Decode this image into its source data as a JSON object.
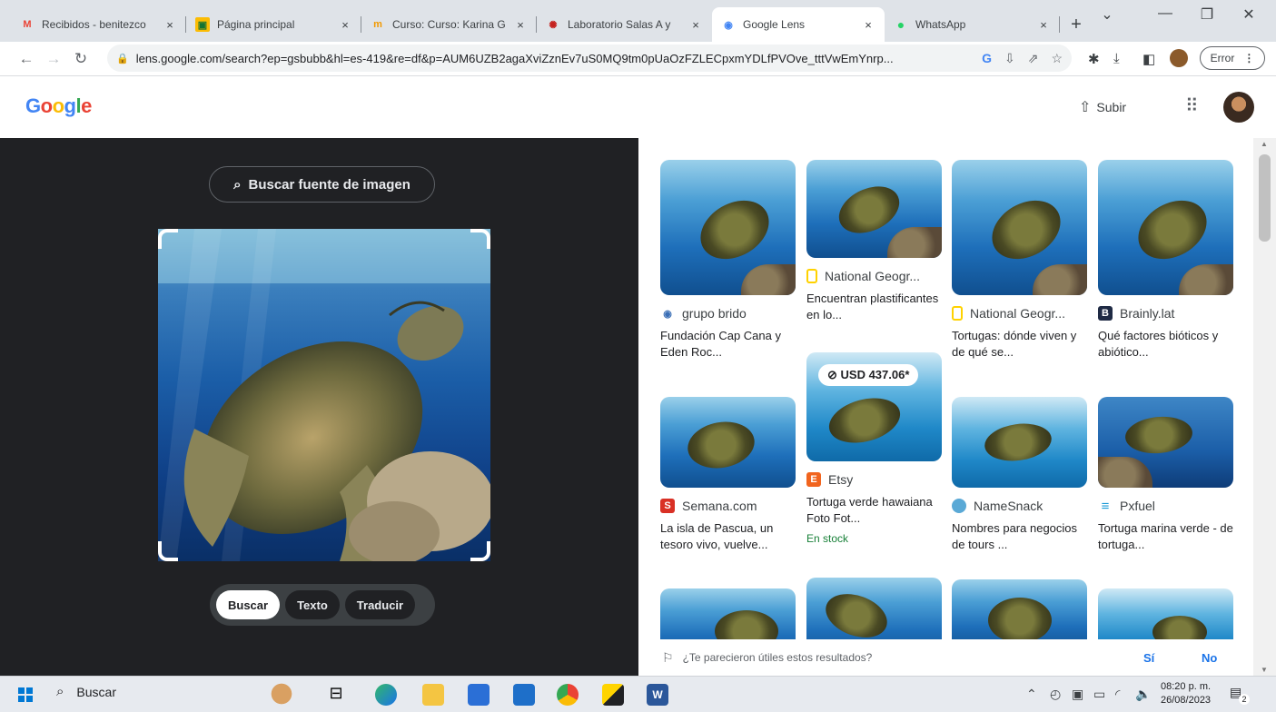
{
  "browser": {
    "tabs": [
      {
        "title": "Recibidos - benitezco",
        "favicon": "M",
        "color": "#ea4335"
      },
      {
        "title": "Página principal",
        "favicon": "▣",
        "color": "#fbbc04"
      },
      {
        "title": "Curso: Curso: Karina G",
        "favicon": "m",
        "color": "#f29900"
      },
      {
        "title": "Laboratorio Salas A y",
        "favicon": "✺",
        "color": "#c5221f"
      },
      {
        "title": "Google Lens",
        "favicon": "◉",
        "color": "#4285f4"
      },
      {
        "title": "WhatsApp",
        "favicon": "●",
        "color": "#25d366"
      }
    ],
    "close_glyph": "×",
    "new_tab": "+",
    "url": "lens.google.com/search?ep=gsbubb&hl=es-419&re=df&p=AUM6UZB2agaXviZznEv7uS0MQ9tm0pUaOzFZLECpxmYDLfPVOve_tttVwEmYnrp...",
    "error_label": "Error"
  },
  "header": {
    "logo": [
      {
        "ch": "G",
        "color": "#4285f4"
      },
      {
        "ch": "o",
        "color": "#ea4335"
      },
      {
        "ch": "o",
        "color": "#fbbc05"
      },
      {
        "ch": "g",
        "color": "#4285f4"
      },
      {
        "ch": "l",
        "color": "#34a853"
      },
      {
        "ch": "e",
        "color": "#ea4335"
      }
    ],
    "upload_label": "Subir"
  },
  "lens": {
    "source_button": "Buscar fuente de imagen",
    "modes": [
      "Buscar",
      "Texto",
      "Traducir"
    ],
    "selected_mode": "Buscar"
  },
  "results": [
    {
      "source": "grupo brido",
      "icon_color": "#3b6fb6",
      "icon_char": "◉",
      "title": "Fundación Cap Cana y Eden Roc..."
    },
    {
      "source": "National Geogr...",
      "icon_color": "#ffd200",
      "icon_char": "",
      "title": "Encuentran plastificantes en lo..."
    },
    {
      "source": "National Geogr...",
      "icon_color": "#ffd200",
      "icon_char": "",
      "title": "Tortugas: dónde viven y de qué se..."
    },
    {
      "source": "Brainly.lat",
      "icon_color": "#1f2a44",
      "icon_char": "B",
      "title": "Qué factores bióticos y abiótico..."
    },
    {
      "source": "Semana.com",
      "icon_color": "#d93025",
      "icon_char": "S",
      "title": "La isla de Pascua, un tesoro vivo, vuelve..."
    },
    {
      "source": "Etsy",
      "icon_color": "#f1641e",
      "icon_char": "E",
      "title": "Tortuga verde hawaiana Foto Fot...",
      "price": "USD 437.06*",
      "stock": "En stock"
    },
    {
      "source": "NameSnack",
      "icon_color": "#5aa9d6",
      "icon_char": "●",
      "title": "Nombres para negocios de tours ..."
    },
    {
      "source": "Pxfuel",
      "icon_color": "#1a9ad6",
      "icon_char": "≡",
      "title": "Tortuga marina verde - de tortuga..."
    }
  ],
  "feedback": {
    "question": "¿Te parecieron útiles estos resultados?",
    "yes": "Sí",
    "no": "No"
  },
  "taskbar": {
    "search_label": "Buscar",
    "time": "08:20 p. m.",
    "date": "26/08/2023",
    "notifications": "2"
  }
}
